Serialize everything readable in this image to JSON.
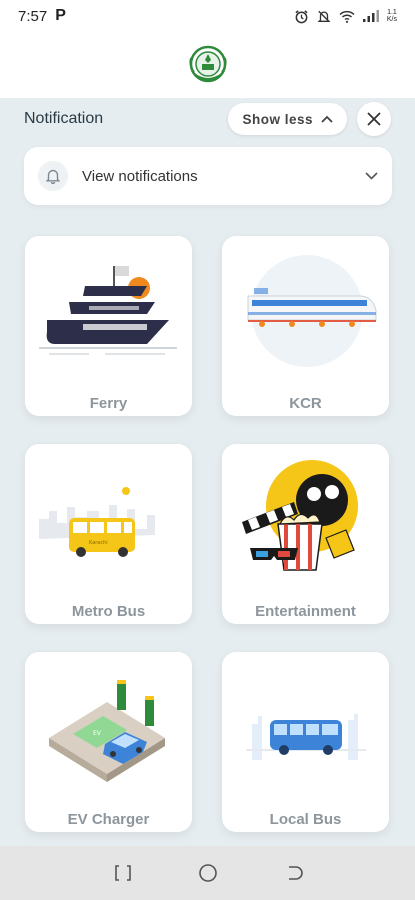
{
  "status": {
    "time": "7:57",
    "carrier_icon": "P",
    "speed_top": "1.1",
    "speed_bottom": "K/s"
  },
  "header": {
    "logo": "kmc-emblem-logo"
  },
  "notification": {
    "title": "Notification",
    "show_less_label": "Show less",
    "view_label": "View notifications"
  },
  "services": [
    {
      "label": "Ferry"
    },
    {
      "label": "KCR"
    },
    {
      "label": "Metro Bus"
    },
    {
      "label": "Entertainment"
    },
    {
      "label": "EV Charger"
    },
    {
      "label": "Local Bus"
    }
  ],
  "bus_sign": "Karachi",
  "ev_sign": "EV",
  "colors": {
    "accent_green": "#2f8a3c",
    "yellow": "#f5c518",
    "blue": "#3d84d8",
    "navy": "#2d2f4a"
  }
}
